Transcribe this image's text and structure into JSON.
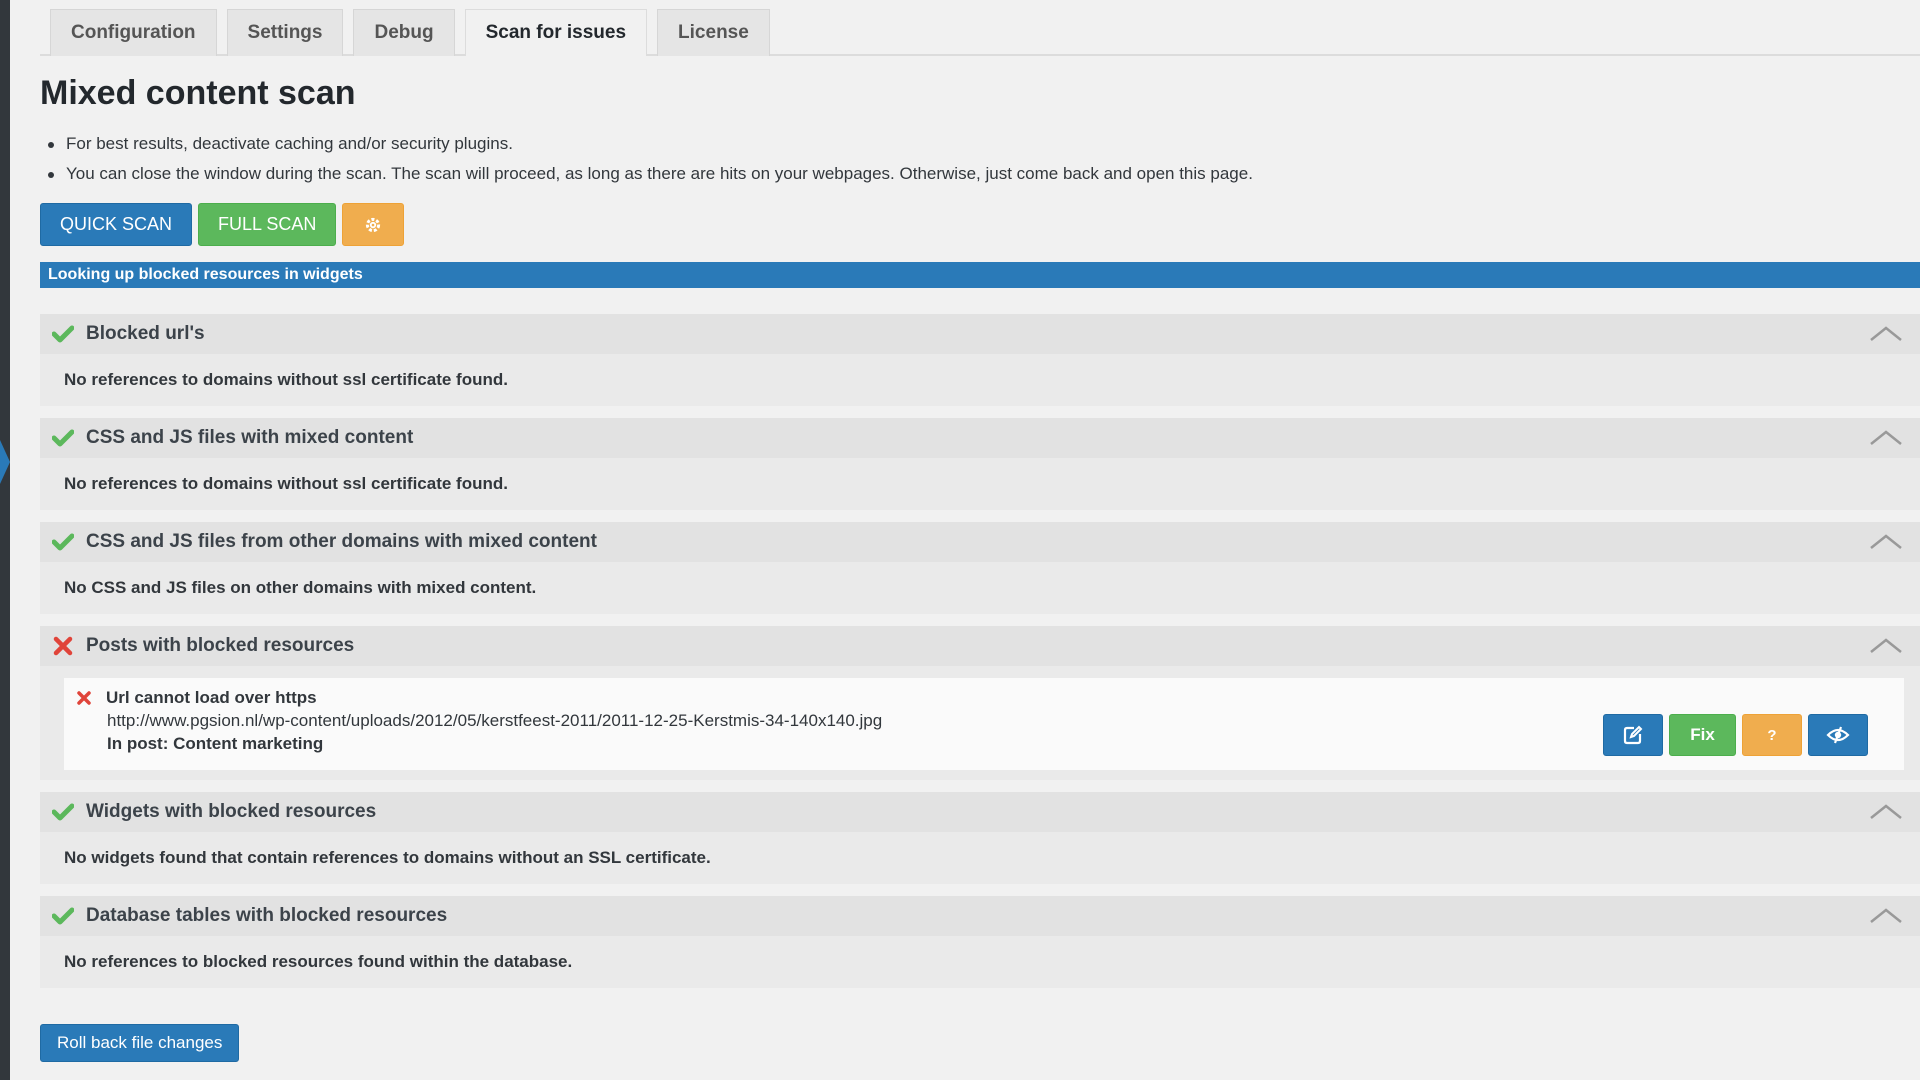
{
  "tabs": [
    {
      "label": "Configuration",
      "active": false
    },
    {
      "label": "Settings",
      "active": false
    },
    {
      "label": "Debug",
      "active": false
    },
    {
      "label": "Scan for issues",
      "active": true
    },
    {
      "label": "License",
      "active": false
    }
  ],
  "page": {
    "title": "Mixed content scan",
    "notes": [
      "For best results, deactivate caching and/or security plugins.",
      "You can close the window during the scan. The scan will proceed, as long as there are hits on your webpages. Otherwise, just come back and open this page."
    ]
  },
  "scan_buttons": {
    "quick_scan": "QUICK SCAN",
    "full_scan": "FULL SCAN",
    "settings_icon": "gear-icon"
  },
  "progress": {
    "text": "Looking up blocked resources in widgets"
  },
  "sections": [
    {
      "status": "ok",
      "title": "Blocked url's",
      "body": "No references to domains without ssl certificate found."
    },
    {
      "status": "ok",
      "title": "CSS and JS files with mixed content",
      "body": "No references to domains without ssl certificate found."
    },
    {
      "status": "ok",
      "title": "CSS and JS files from other domains with mixed content",
      "body": "No CSS and JS files on other domains with mixed content."
    },
    {
      "status": "error",
      "title": "Posts with blocked resources",
      "body": ""
    },
    {
      "status": "ok",
      "title": "Widgets with blocked resources",
      "body": "No widgets found that contain references to domains without an SSL certificate."
    },
    {
      "status": "ok",
      "title": "Database tables with blocked resources",
      "body": "No references to blocked resources found within the database."
    }
  ],
  "issue": {
    "title": "Url cannot load over https",
    "url": "http://www.pgsion.nl/wp-content/uploads/2012/05/kerstfeest-2011/2011-12-25-Kerstmis-34-140x140.jpg",
    "in_post": "In post: Content marketing",
    "actions": {
      "edit_icon": "edit-icon",
      "fix_label": "Fix",
      "help_label": "?",
      "ignore_icon": "hide-icon"
    }
  },
  "footer": {
    "rollback_label": "Roll back file changes"
  },
  "colors": {
    "blue": "#2a7ab8",
    "green": "#5cb85c",
    "orange": "#f0ad4e",
    "ok_check": "#5cb85c",
    "error_x": "#e0443a"
  }
}
